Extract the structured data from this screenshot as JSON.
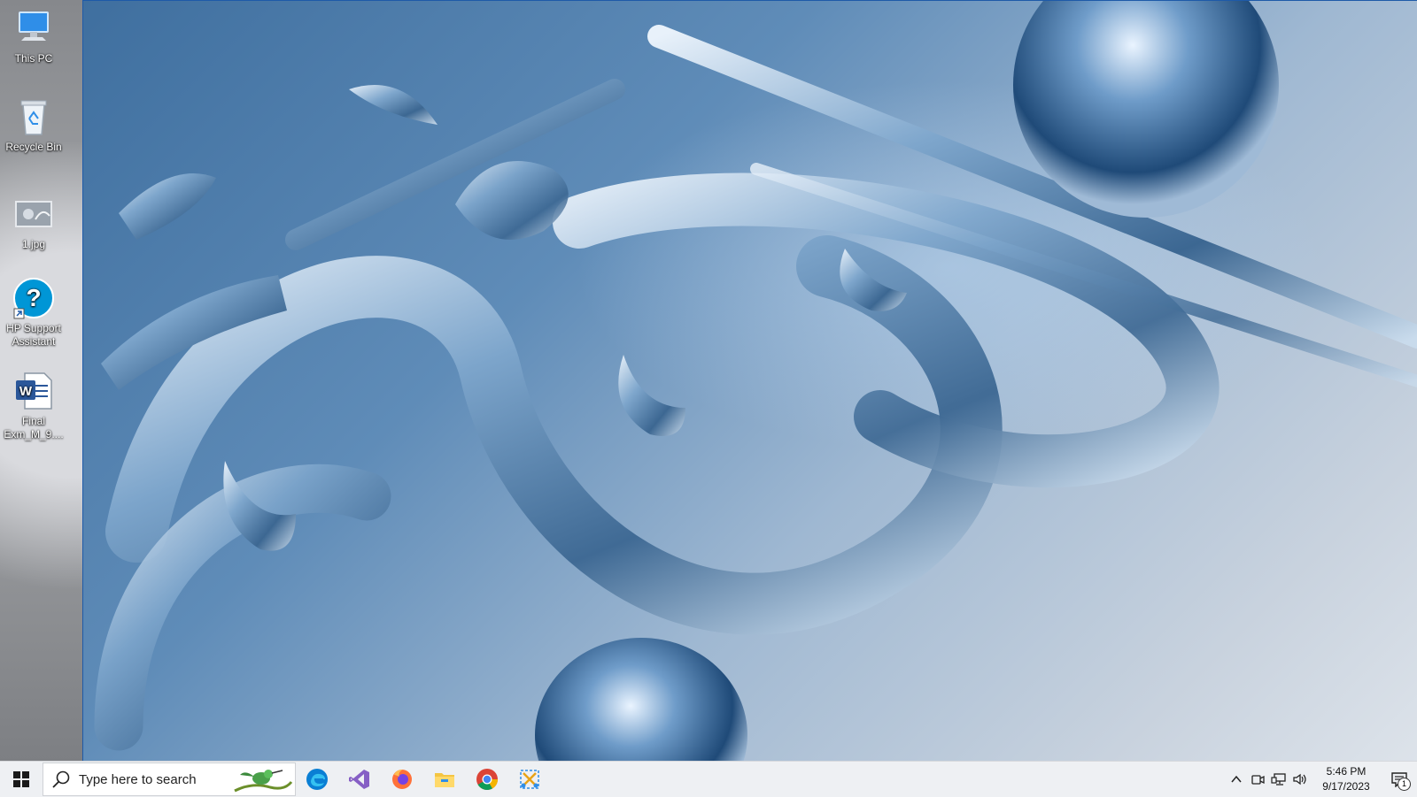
{
  "desktop": {
    "icons": [
      {
        "label": "This PC",
        "icon": "this-pc-icon"
      },
      {
        "label": "Recycle Bin",
        "icon": "recycle-bin-icon"
      },
      {
        "label": "1.jpg",
        "icon": "image-file-icon"
      },
      {
        "label": "HP Support Assistant",
        "icon": "help-question-icon"
      },
      {
        "label": "Final Exm_M_9....",
        "icon": "word-document-icon"
      }
    ]
  },
  "taskbar": {
    "search": {
      "placeholder": "Type here to search"
    },
    "apps": [
      {
        "icon": "edge-icon"
      },
      {
        "icon": "visual-studio-icon"
      },
      {
        "icon": "firefox-icon"
      },
      {
        "icon": "file-explorer-icon"
      },
      {
        "icon": "chrome-icon"
      },
      {
        "icon": "snipping-tool-icon"
      }
    ],
    "tray": {
      "time": "5:46 PM",
      "date": "9/17/2023",
      "notification_count": "1"
    }
  },
  "colors": {
    "accent": "#1e5aa8",
    "taskbar_bg": "#eef0f3"
  }
}
